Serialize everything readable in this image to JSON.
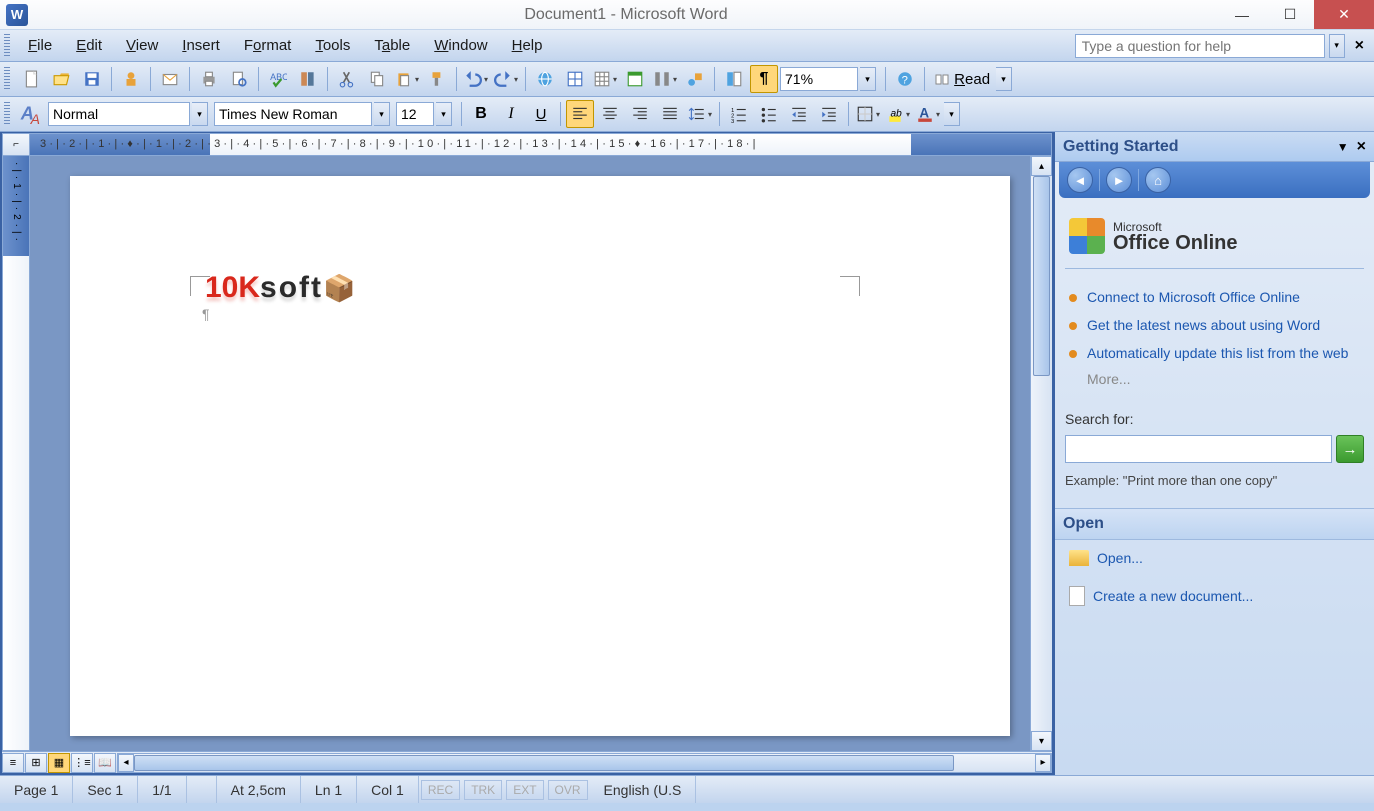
{
  "window": {
    "title": "Document1 - Microsoft Word"
  },
  "menu": {
    "items": [
      "File",
      "Edit",
      "View",
      "Insert",
      "Format",
      "Tools",
      "Table",
      "Window",
      "Help"
    ],
    "help_placeholder": "Type a question for help"
  },
  "standard_toolbar": {
    "zoom": "71%",
    "read_label": "Read"
  },
  "format_toolbar": {
    "style": "Normal",
    "font": "Times New Roman",
    "size": "12"
  },
  "ruler": {
    "h_text": "3·|·2·|·1·|·♦·|·1·|·2·|·3·|·4·|·5·|·6·|·7·|·8·|·9·|·10·|·11·|·12·|·13·|·14·|·15·♦·16·|·17·|·18·|",
    "v_text": "·|·1·|·2·|·"
  },
  "document": {
    "watermark_a": "10K",
    "watermark_b": "soft"
  },
  "taskpane": {
    "title": "Getting Started",
    "office_small": "Microsoft",
    "office_big": "Office Online",
    "links": [
      "Connect to Microsoft Office Online",
      "Get the latest news about using Word",
      "Automatically update this list from the web"
    ],
    "more": "More...",
    "search_label": "Search for:",
    "example": "Example:  \"Print more than one copy\"",
    "open_header": "Open",
    "open_link": "Open...",
    "create_link": "Create a new document..."
  },
  "status": {
    "page": "Page  1",
    "sec": "Sec  1",
    "pages": "1/1",
    "at": "At  2,5cm",
    "ln": "Ln  1",
    "col": "Col  1",
    "rec": "REC",
    "trk": "TRK",
    "ext": "EXT",
    "ovr": "OVR",
    "lang": "English (U.S"
  }
}
